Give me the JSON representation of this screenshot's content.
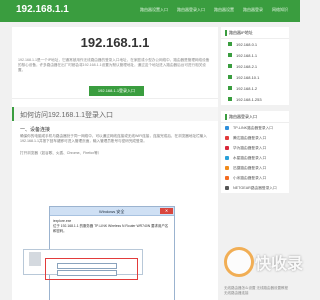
{
  "header": {
    "logo": "192.168.1.1",
    "nav": [
      "路由器设置入口",
      "路由器登录入口",
      "路由器设置",
      "路由器登录",
      "网络知识"
    ]
  },
  "main": {
    "title": "192.168.1.1",
    "intro": "192.168.1.1是一个IP地址，它通常被用作无线路由器的登录入口地址，在家庭或小型办公网络中，路由器是管理网络设备的核心设备，许多路由器在出厂时都会将192.168.1.1设置为默认管理地址，通过这个地址进入路由器后台可进行相关设置。",
    "login_button": "192.168.1.1登录入口",
    "section_title": "如何访问192.168.1.1登录入口",
    "subsection": "一、设备连接",
    "body": "确保你的电脑或手机与路由器处于同一网络中，可以通过网线连接或无线WiFi连接，连接完成后，在浏览器地址栏输入192.168.1.1并按下回车键即可进入管理页面，输入管理员账号与密码完成登录。",
    "open_text": "打开浏览器（如谷歌、火狐、Chrome、Firefox等）",
    "screenshot": {
      "window_title": "Windows 安全",
      "close_label": "✕",
      "body_line1": "iexplore.exe",
      "body_line2": "位于 192.168.1.1 的服务器 TP-LINK Wireless N Router WR740N 要求用户名和密码。"
    }
  },
  "sidebar": {
    "card1_title": "路由器IP地址",
    "ip_items": [
      "192.168.0.1",
      "192.168.1.1",
      "192.168.2.1",
      "192.168.10.1",
      "192.168.1.2",
      "192.168.1.253"
    ],
    "card2_title": "路由器登录入口",
    "router_items": [
      {
        "label": "TP-LINK路由器登录入口",
        "color": "#2f8fdb"
      },
      {
        "label": "腾达路由器登录入口",
        "color": "#e23b3b"
      },
      {
        "label": "华为路由器登录入口",
        "color": "#d8273a"
      },
      {
        "label": "水星路由器登录入口",
        "color": "#2aa0d8"
      },
      {
        "label": "迅捷路由器登录入口",
        "color": "#f08a1c"
      },
      {
        "label": "小米路由器登录入口",
        "color": "#f36b21"
      },
      {
        "label": "NETGEAR路由器登录入口",
        "color": "#555555"
      }
    ],
    "bottom_links": [
      "无线路由器怎么设置 无线路由器设置教程",
      "无线路由器连接"
    ]
  },
  "watermark": "快收录"
}
